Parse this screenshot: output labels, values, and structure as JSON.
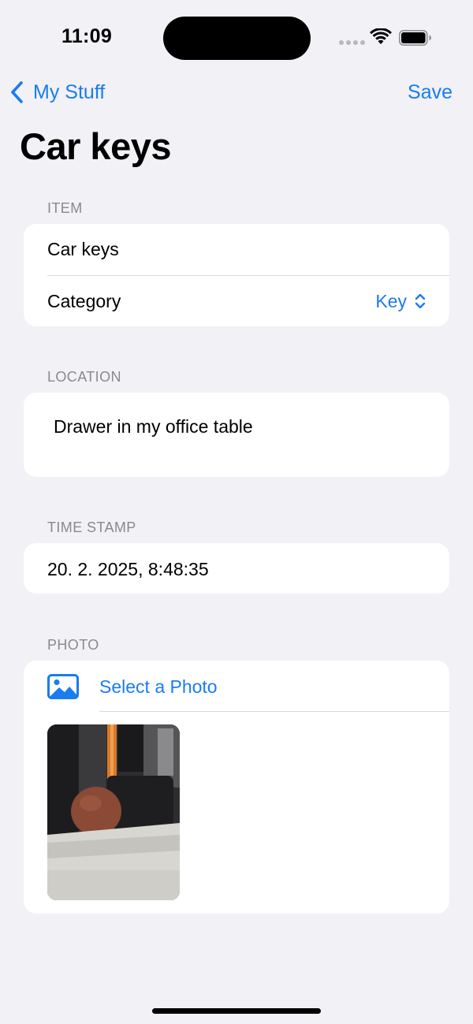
{
  "status_bar": {
    "time": "11:09"
  },
  "nav": {
    "back_label": "My Stuff",
    "save_label": "Save"
  },
  "page": {
    "title": "Car keys"
  },
  "item_section": {
    "header": "ITEM",
    "name_value": "Car keys",
    "category_label": "Category",
    "category_value": "Key"
  },
  "location_section": {
    "header": "LOCATION",
    "value": "Drawer in my office table"
  },
  "timestamp_section": {
    "header": "TIME STAMP",
    "value": "20. 2. 2025, 8:48:35"
  },
  "photo_section": {
    "header": "PHOTO",
    "select_label": "Select a Photo"
  },
  "colors": {
    "accent": "#1a7cf0",
    "background": "#f1f1f6",
    "card": "#ffffff"
  },
  "icons": [
    "chevron-left-icon",
    "chevron-up-down-icon",
    "photo-icon",
    "wifi-icon",
    "battery-icon"
  ]
}
